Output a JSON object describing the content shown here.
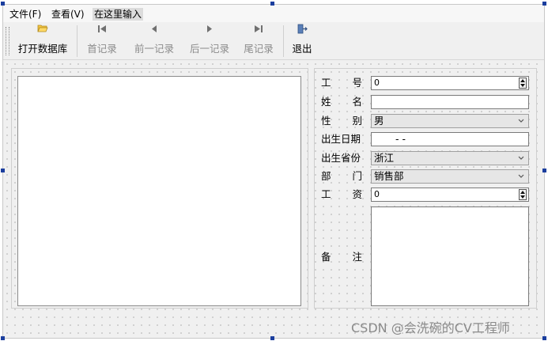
{
  "menubar": {
    "items": [
      {
        "label": "文件(F)"
      },
      {
        "label": "查看(V)"
      }
    ],
    "type_here": "在这里输入"
  },
  "toolbar": {
    "buttons": [
      {
        "label": "打开数据库",
        "icon": "folder-open-icon",
        "enabled": true
      },
      {
        "label": "首记录",
        "icon": "first-record-icon",
        "enabled": false
      },
      {
        "label": "前一记录",
        "icon": "previous-record-icon",
        "enabled": false
      },
      {
        "label": "后一记录",
        "icon": "next-record-icon",
        "enabled": false
      },
      {
        "label": "尾记录",
        "icon": "last-record-icon",
        "enabled": false
      },
      {
        "label": "退出",
        "icon": "exit-door-icon",
        "enabled": true
      }
    ]
  },
  "form": {
    "labels": {
      "emp_no": [
        "工",
        "号"
      ],
      "name": [
        "姓",
        "名"
      ],
      "gender": [
        "性",
        "别"
      ],
      "birthdate": "出生日期",
      "province": "出生省份",
      "department": [
        "部",
        "门"
      ],
      "salary": [
        "工",
        "资"
      ],
      "memo": [
        "备",
        "注"
      ]
    },
    "values": {
      "emp_no": "0",
      "name": "",
      "gender": "男",
      "birthdate": "-   -",
      "province": "浙江",
      "department": "销售部",
      "salary": "0",
      "memo": ""
    }
  },
  "watermark": "CSDN @会洗碗的CV工程师",
  "colors": {
    "handle": "#1b3e9e",
    "canvas": "#f0f0f0",
    "disabled_text": "#8c8c8c"
  }
}
